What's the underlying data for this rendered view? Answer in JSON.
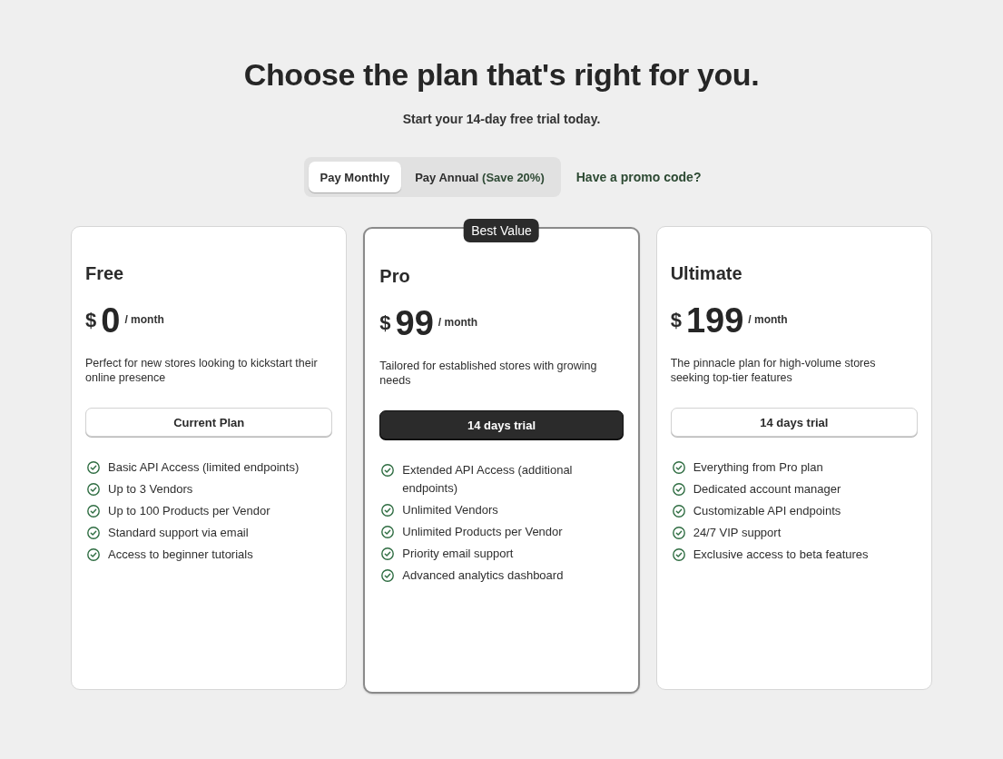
{
  "header": {
    "title": "Choose the plan that's right for you.",
    "subtitle": "Start your 14-day free trial today."
  },
  "billing_toggle": [
    {
      "label": "Pay Monthly",
      "selected": true
    },
    {
      "label": "Pay Annual",
      "note": "(Save 20%)",
      "selected": false
    }
  ],
  "promo_link": "Have a promo code?",
  "plans": [
    {
      "name": "Free",
      "featured": false,
      "currency": "$",
      "price": "0",
      "period": "/ month",
      "description": "Perfect for new stores looking to kickstart their online presence",
      "button": {
        "label": "Current Plan",
        "kind": "secondary"
      },
      "features": [
        "Basic API Access (limited endpoints)",
        "Up to 3 Vendors",
        "Up to 100 Products per Vendor",
        "Standard support via email",
        "Access to beginner tutorials"
      ]
    },
    {
      "name": "Pro",
      "featured": true,
      "badge": "Best Value",
      "currency": "$",
      "price": "99",
      "period": "/ month",
      "description": "Tailored for established stores with growing needs",
      "button": {
        "label": "14 days trial",
        "kind": "primary"
      },
      "features": [
        "Extended API Access (additional endpoints)",
        "Unlimited Vendors",
        "Unlimited Products per Vendor",
        "Priority email support",
        "Advanced analytics dashboard"
      ]
    },
    {
      "name": "Ultimate",
      "featured": false,
      "currency": "$",
      "price": "199",
      "period": "/ month",
      "description": "The pinnacle plan for high-volume stores seeking top-tier features",
      "button": {
        "label": "14 days trial",
        "kind": "secondary"
      },
      "features": [
        "Everything from Pro plan",
        "Dedicated account manager",
        "Customizable API endpoints",
        "24/7 VIP support",
        "Exclusive access to beta features"
      ]
    }
  ]
}
